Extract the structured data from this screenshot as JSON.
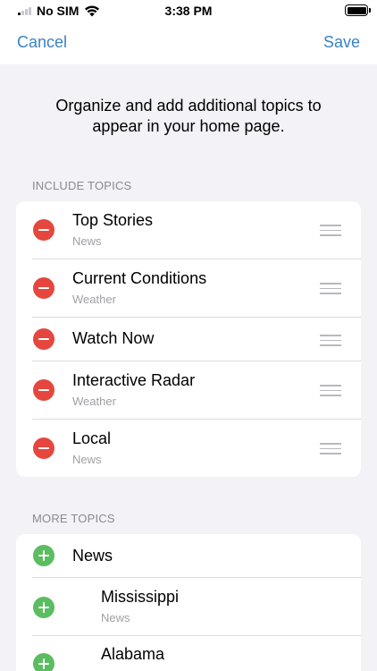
{
  "status_bar": {
    "carrier": "No SIM",
    "time": "3:38 PM"
  },
  "nav": {
    "cancel_label": "Cancel",
    "save_label": "Save"
  },
  "intro_text": "Organize and add additional topics to appear in your home page.",
  "include_topics": {
    "header": "INCLUDE TOPICS",
    "items": [
      {
        "title": "Top Stories",
        "subtitle": "News"
      },
      {
        "title": "Current Conditions",
        "subtitle": "Weather"
      },
      {
        "title": "Watch Now",
        "subtitle": ""
      },
      {
        "title": "Interactive Radar",
        "subtitle": "Weather"
      },
      {
        "title": "Local",
        "subtitle": "News"
      }
    ]
  },
  "more_topics": {
    "header": "MORE TOPICS",
    "items": [
      {
        "title": "News",
        "subtitle": ""
      },
      {
        "title": "Mississippi",
        "subtitle": "News"
      },
      {
        "title": "Alabama",
        "subtitle": ""
      }
    ]
  },
  "colors": {
    "accent": "#3b82c4",
    "remove": "#e5473f",
    "add": "#5bbd60",
    "background": "#f2f2f7"
  },
  "icons": {
    "signal": "cellular-signal-icon",
    "wifi": "wifi-icon",
    "battery": "battery-icon",
    "remove": "minus-circle-icon",
    "add": "plus-circle-icon",
    "reorder": "reorder-handle-icon"
  }
}
